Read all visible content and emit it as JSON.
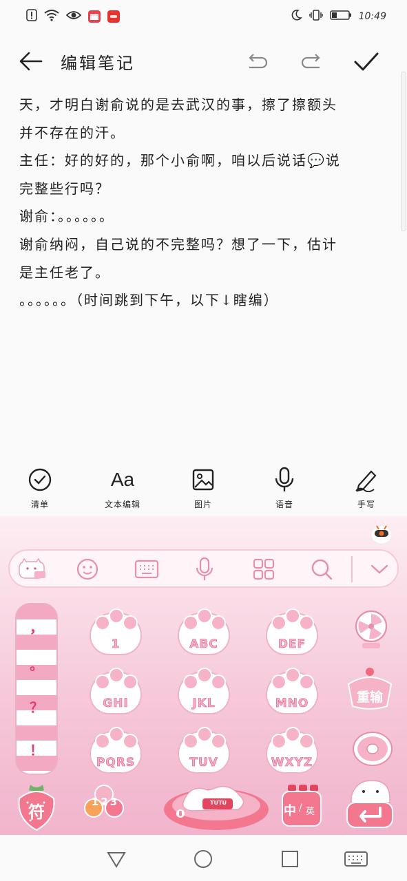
{
  "status": {
    "time": "10:49",
    "left_icons": [
      "alert-icon",
      "wifi-icon",
      "eye-icon",
      "calendar-app-icon",
      "huawei-app-icon"
    ],
    "right_icons": [
      "moon-icon",
      "vibrate-icon",
      "battery-icon"
    ],
    "battery_level": 0.3
  },
  "header": {
    "title": "编辑笔记",
    "back_icon": "back-arrow-icon",
    "undo_icon": "undo-icon",
    "redo_icon": "redo-icon",
    "done_icon": "check-icon"
  },
  "note": {
    "lines": [
      "天，才明白谢俞说的是去武汉的事，擦了擦额头",
      "并不存在的汗。",
      "主任：好的好的，那个小俞啊，咱以后说话💬说",
      "完整些行吗？",
      "谢俞：。。。。。。",
      "谢俞纳闷，自己说的不完整吗？想了一下，估计",
      "是主任老了。",
      "。。。。。。（时间跳到下午，以下↓瞎编）"
    ]
  },
  "toolbar": {
    "items": [
      {
        "label": "清单",
        "icon": "checklist-icon"
      },
      {
        "label": "文本编辑",
        "icon": "text-format-icon",
        "glyph": "Aa"
      },
      {
        "label": "图片",
        "icon": "image-icon"
      },
      {
        "label": "语音",
        "icon": "microphone-icon"
      },
      {
        "label": "手写",
        "icon": "handwriting-icon"
      }
    ]
  },
  "keyboard": {
    "top_icons": [
      "cat-logo-icon",
      "emoji-icon",
      "keyboard-layout-icon",
      "voice-icon",
      "apps-grid-icon",
      "search-icon",
      "collapse-icon"
    ],
    "punctuation": [
      "，",
      "。",
      "？",
      "！"
    ],
    "keys": [
      {
        "label": "1"
      },
      {
        "label": "ABC"
      },
      {
        "label": "DEF"
      },
      {
        "label": "GHI"
      },
      {
        "label": "JKL"
      },
      {
        "label": "MNO"
      },
      {
        "label": "PQRS"
      },
      {
        "label": "TUV"
      },
      {
        "label": "WXYZ"
      }
    ],
    "right_keys": {
      "retype": "重输",
      "delete_icon": "fan-delete-icon",
      "zero_icon": "donut-zero-icon"
    },
    "bottom": {
      "symbol": "符",
      "numbers": "123",
      "space_brand": "TUTU",
      "lang_main": "中",
      "lang_alt": "英",
      "enter_icon": "enter-icon"
    }
  },
  "nav": {
    "icons": [
      "back-triangle-icon",
      "home-circle-icon",
      "recents-square-icon",
      "keyboard-switch-icon"
    ]
  }
}
